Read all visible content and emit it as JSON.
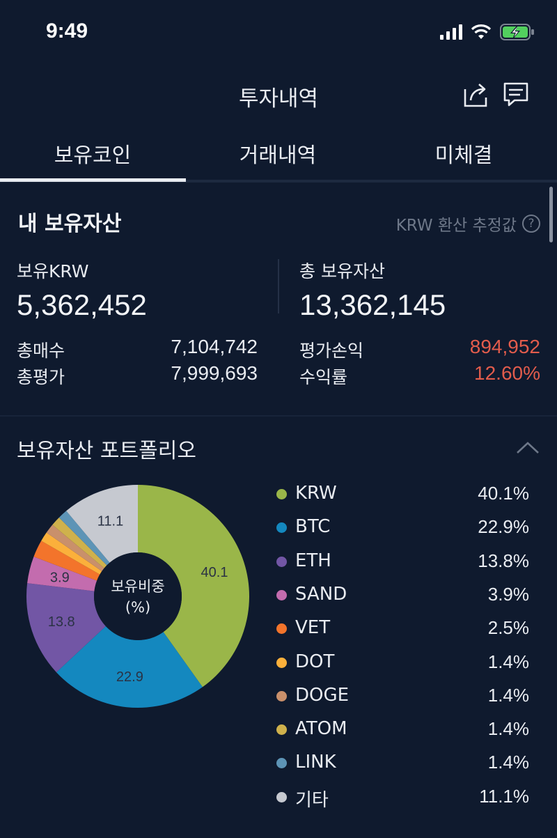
{
  "status": {
    "time": "9:49"
  },
  "header": {
    "title": "투자내역"
  },
  "tabs": [
    {
      "label": "보유코인",
      "active": true
    },
    {
      "label": "거래내역",
      "active": false
    },
    {
      "label": "미체결",
      "active": false
    }
  ],
  "assets": {
    "title": "내 보유자산",
    "note": "KRW 환산 추정값",
    "help": "?",
    "held_krw_label": "보유KRW",
    "held_krw_value": "5,362,452",
    "total_assets_label": "총 보유자산",
    "total_assets_value": "13,362,145",
    "total_buy_label": "총매수",
    "total_buy_value": "7,104,742",
    "total_eval_label": "총평가",
    "total_eval_value": "7,999,693",
    "pnl_label": "평가손익",
    "pnl_value": "894,952",
    "return_label": "수익률",
    "return_value": "12.60%",
    "accent_red": "#e25c4c"
  },
  "portfolio": {
    "title": "보유자산 포트폴리오",
    "center_line1": "보유비중",
    "center_line2": "(%)"
  },
  "chart_data": {
    "type": "pie",
    "categories": [
      "KRW",
      "BTC",
      "ETH",
      "SAND",
      "VET",
      "DOT",
      "DOGE",
      "ATOM",
      "LINK",
      "기타"
    ],
    "values": [
      40.1,
      22.9,
      13.8,
      3.9,
      2.5,
      1.4,
      1.4,
      1.4,
      1.4,
      11.1
    ],
    "labels_pct": [
      "40.1%",
      "22.9%",
      "13.8%",
      "3.9%",
      "2.5%",
      "1.4%",
      "1.4%",
      "1.4%",
      "1.4%",
      "11.1%"
    ],
    "slice_labels": [
      "40.1",
      "22.9",
      "13.8",
      "3.9",
      "",
      "",
      "",
      "",
      "",
      "11.1"
    ],
    "colors": [
      "#9ab649",
      "#1488bf",
      "#7256a5",
      "#c36cae",
      "#f3742b",
      "#fbb03b",
      "#c9906b",
      "#cfb14c",
      "#5d94b6",
      "#c6c9d0"
    ],
    "donut": true,
    "legend_position": "right"
  }
}
